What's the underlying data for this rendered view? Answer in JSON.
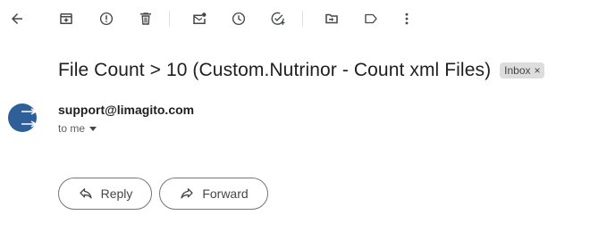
{
  "toolbar": {
    "buttons": [
      {
        "icon": "back-arrow-icon",
        "label": "Back to Inbox"
      },
      {
        "icon": "archive-icon",
        "label": "Archive"
      },
      {
        "icon": "report-spam-icon",
        "label": "Report spam"
      },
      {
        "icon": "delete-icon",
        "label": "Delete"
      },
      {
        "icon": "mark-unread-icon",
        "label": "Mark as unread"
      },
      {
        "icon": "snooze-icon",
        "label": "Snooze"
      },
      {
        "icon": "add-task-icon",
        "label": "Add to Tasks"
      },
      {
        "icon": "move-to-icon",
        "label": "Move to"
      },
      {
        "icon": "labels-icon",
        "label": "Labels"
      },
      {
        "icon": "more-vert-icon",
        "label": "More"
      }
    ]
  },
  "email": {
    "subject": "File Count > 10 (Custom.Nutrinor - Count xml Files)",
    "label_chip": "Inbox",
    "label_chip_close": "×",
    "sender": "support@limagito.com",
    "recipient": "to me"
  },
  "actions": {
    "reply_label": "Reply",
    "forward_label": "Forward"
  },
  "colors": {
    "icon": "#444746",
    "avatar_bg": "#2f5f98",
    "chip_bg": "#dddddd",
    "button_border": "#747775"
  }
}
